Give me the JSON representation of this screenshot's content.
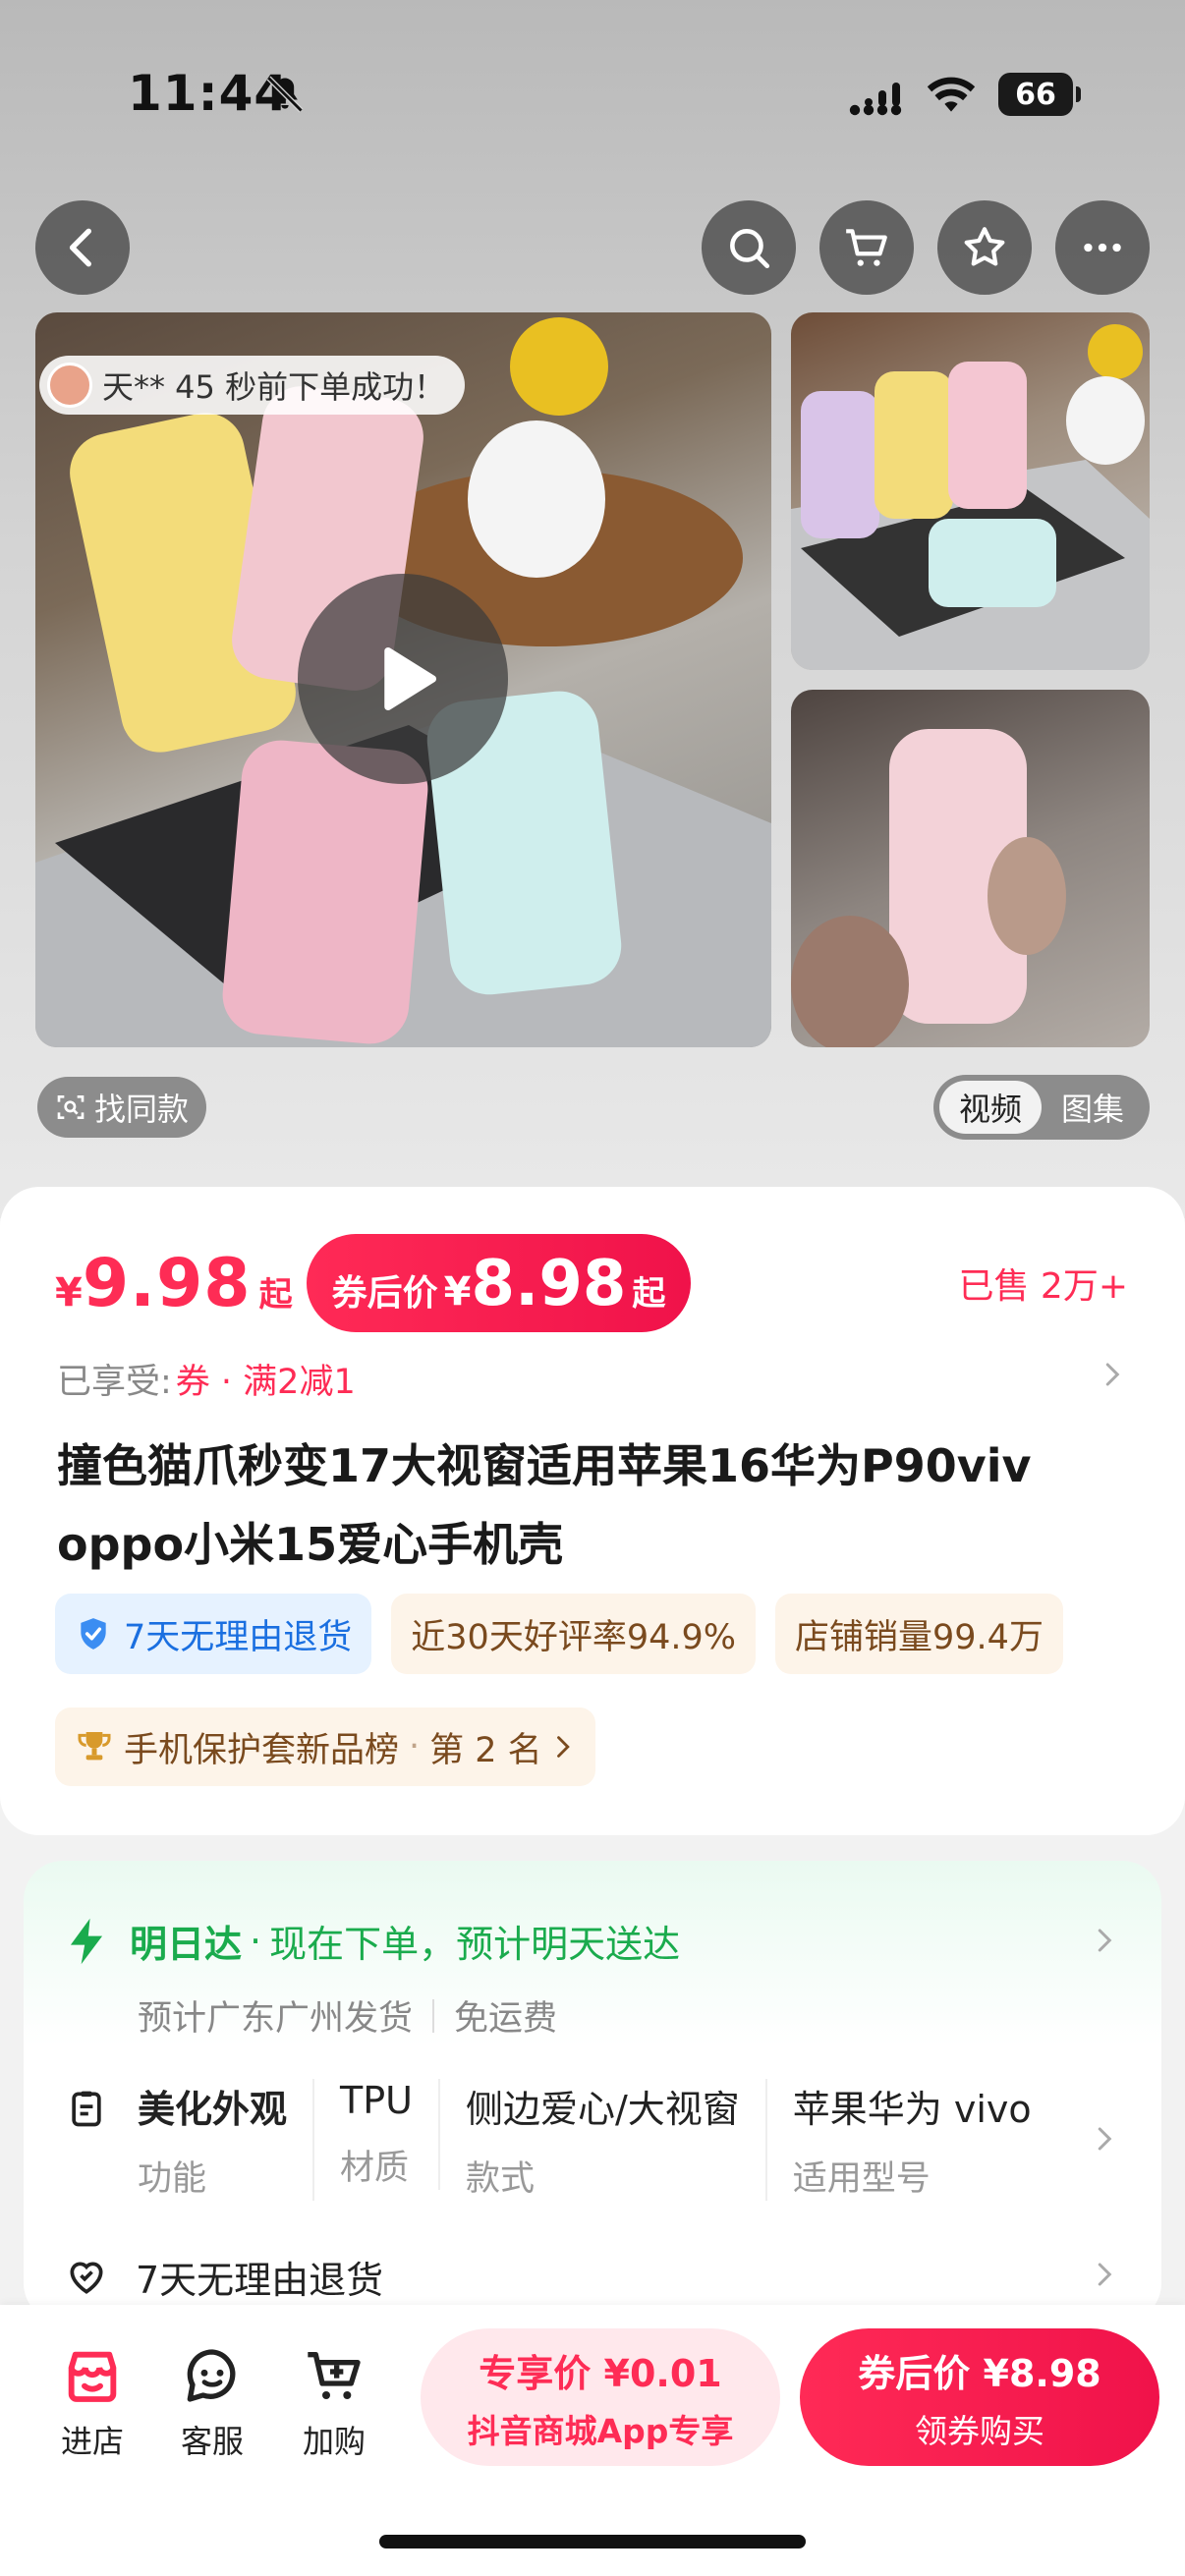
{
  "status_bar": {
    "time": "11:44",
    "battery": "66"
  },
  "gallery": {
    "order_toast": "天** 45 秒前下单成功！",
    "find_same": "找同款",
    "toggle": [
      "视频",
      "图集"
    ],
    "active_toggle": "视频"
  },
  "price": {
    "currency": "¥",
    "value": "9.98",
    "suffix": "起",
    "coupon_label": "券后价",
    "coupon_value": "8.98",
    "sold": "已售 2万+"
  },
  "enjoy": {
    "label": "已享受:",
    "promo": "券 · 满2减1"
  },
  "title": "撞色猫爪秒变17大视窗适用苹果16华为P90viv oppo小米15爱心手机壳",
  "tags": [
    "7天无理由退货",
    "近30天好评率94.9%",
    "店铺销量99.4万"
  ],
  "rank": {
    "label": "手机保护套新品榜",
    "sep": "·",
    "position": "第 2 名"
  },
  "delivery": {
    "title": "明日达",
    "sep": "·",
    "text": "现在下单，预计明天送达",
    "origin": "预计广东广州发货",
    "shipping": "免运费"
  },
  "attributes": [
    {
      "value": "美化外观",
      "key": "功能"
    },
    {
      "value": "TPU",
      "key": "材质"
    },
    {
      "value": "侧边爱心/大视窗",
      "key": "款式"
    },
    {
      "value": "苹果华为 vivo",
      "key": "适用型号"
    }
  ],
  "returns": "7天无理由退货",
  "bottom_bar": {
    "store": "进店",
    "service": "客服",
    "add_cart": "加购",
    "exclusive_l1": "专享价 ¥0.01",
    "exclusive_l2": "抖音商城App专享",
    "buy_l1": "券后价 ¥8.98",
    "buy_l2": "领券购买"
  },
  "colors": {
    "accent": "#fe2c55",
    "green": "#1aab4d",
    "blue": "#1a6fe0"
  }
}
